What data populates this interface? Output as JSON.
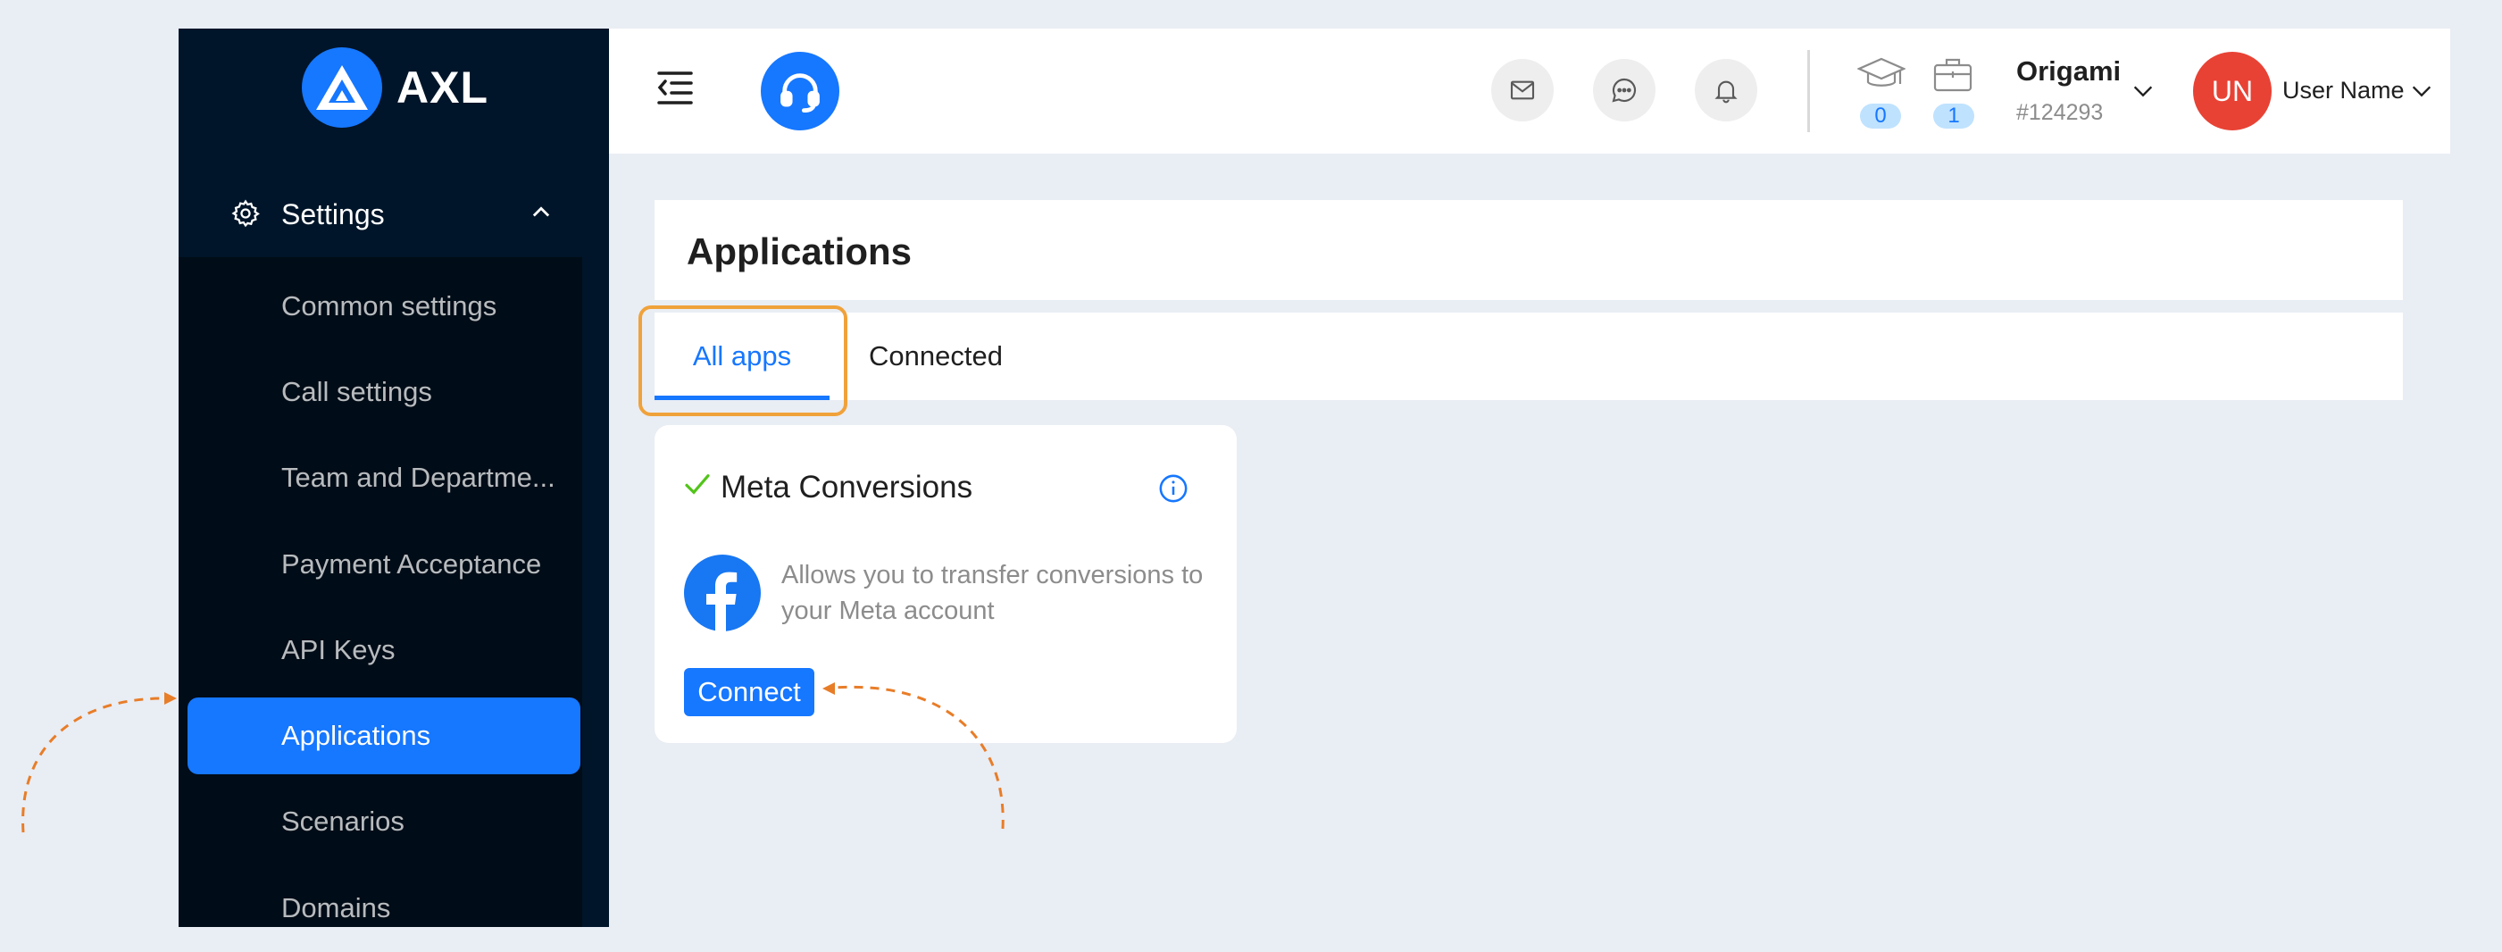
{
  "brand": {
    "name": "AXL",
    "logo_icon": "axl-triangle-logo",
    "accent_color": "#1677ff"
  },
  "sidebar": {
    "section": {
      "label": "Settings",
      "icon": "gear-icon",
      "expanded": true
    },
    "items": [
      {
        "label": "Common settings",
        "active": false
      },
      {
        "label": "Call settings",
        "active": false
      },
      {
        "label": "Team and Departme...",
        "active": false
      },
      {
        "label": "Payment Acceptance",
        "active": false
      },
      {
        "label": "API Keys",
        "active": false
      },
      {
        "label": "Applications",
        "active": true
      },
      {
        "label": "Scenarios",
        "active": false
      },
      {
        "label": "Domains",
        "active": false
      }
    ]
  },
  "header": {
    "icons": [
      "menu-fold-icon",
      "headset-icon",
      "mail-icon",
      "chat-icon",
      "bell-icon"
    ],
    "counters": [
      {
        "icon": "graduation-cap-icon",
        "value": "0"
      },
      {
        "icon": "briefcase-icon",
        "value": "1"
      }
    ],
    "organization": {
      "name": "Origami",
      "id": "#124293"
    },
    "user": {
      "initials": "UN",
      "name": "User Name",
      "avatar_color": "#e84235"
    }
  },
  "main": {
    "title": "Applications",
    "tabs": [
      {
        "label": "All apps",
        "active": true
      },
      {
        "label": "Connected",
        "active": false
      }
    ],
    "apps": [
      {
        "name": "Meta Conversions",
        "status_icon": "check-icon",
        "icon": "facebook-icon",
        "description": "Allows you to transfer conversions to your Meta account",
        "action_label": "Connect"
      }
    ]
  },
  "annotations": {
    "highlight_color": "#f0a23a"
  }
}
